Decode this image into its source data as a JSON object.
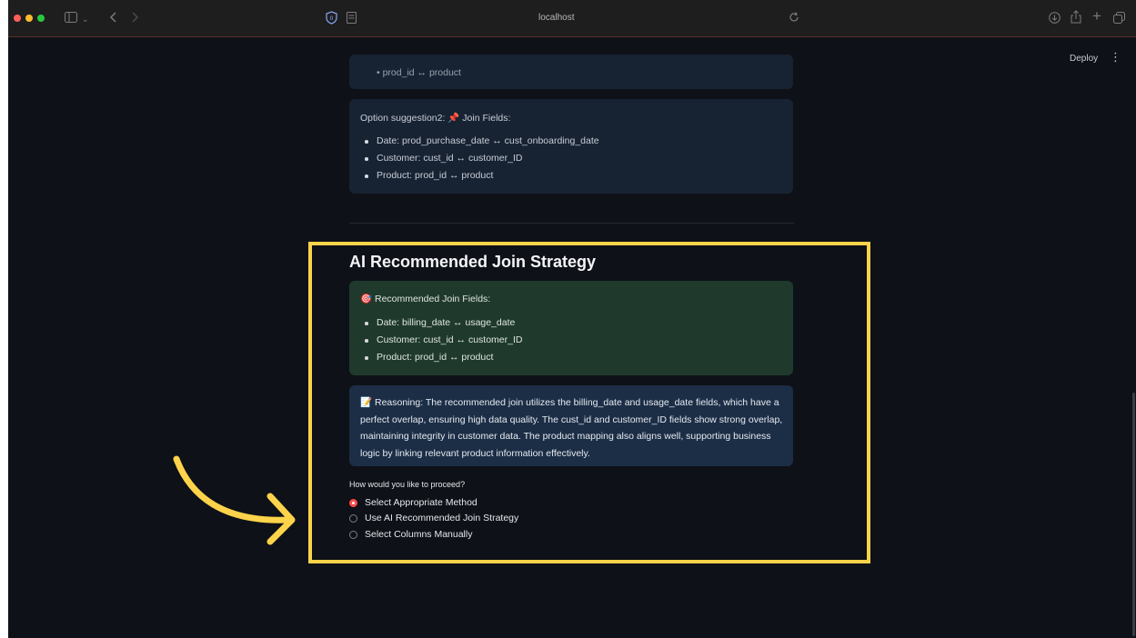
{
  "browser": {
    "url": "localhost",
    "traffic_light_colors": [
      "#ff5f57",
      "#febc2e",
      "#28c840"
    ]
  },
  "app_header": {
    "deploy_label": "Deploy",
    "menu_icon": "⋮"
  },
  "partial_card": {
    "text": "• prod_id ↔ product"
  },
  "option2": {
    "title": "Option suggestion2: 📌 Join Fields:",
    "items": [
      "Date: prod_purchase_date ↔ cust_onboarding_date",
      "Customer: cust_id ↔ customer_ID",
      "Product: prod_id ↔ product"
    ]
  },
  "recommendation": {
    "heading": "AI Recommended Join Strategy",
    "fields_title": "🎯 Recommended Join Fields:",
    "items": [
      "Date: billing_date ↔ usage_date",
      "Customer: cust_id ↔ customer_ID",
      "Product: prod_id ↔ product"
    ],
    "reasoning": "📝 Reasoning: The recommended join utilizes the billing_date and usage_date fields, which have a perfect overlap, ensuring high data quality. The cust_id and customer_ID fields show strong overlap, maintaining integrity in customer data. The product mapping also aligns well, supporting business logic by linking relevant product information effectively."
  },
  "proceed": {
    "question": "How would you like to proceed?",
    "options": [
      {
        "label": "Select Appropriate Method",
        "selected": true
      },
      {
        "label": "Use AI Recommended Join Strategy",
        "selected": false
      },
      {
        "label": "Select Columns Manually",
        "selected": false
      }
    ]
  },
  "annotation": {
    "highlight_color": "#fcd34a"
  }
}
